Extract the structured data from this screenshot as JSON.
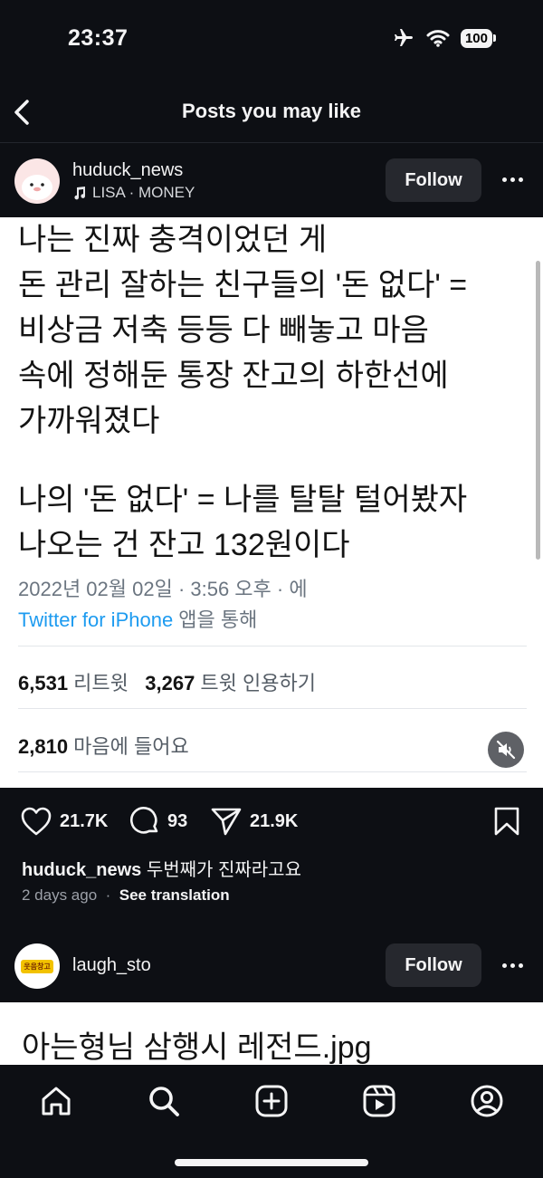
{
  "status_bar": {
    "time": "23:37",
    "battery": "100"
  },
  "nav": {
    "title": "Posts you may like"
  },
  "post1": {
    "username": "huduck_news",
    "music": "LISA · MONEY",
    "follow_label": "Follow",
    "tweet_lines": [
      "나는 진짜 충격이었던 게",
      "돈 관리 잘하는 친구들의 '돈 없다' =",
      "비상금 저축 등등 다 빼놓고 마음",
      "속에 정해둔 통장 잔고의 하한선에",
      "가까워졌다",
      "나의 '돈 없다' = 나를 탈탈 털어봤자",
      "나오는 건 잔고 132원이다"
    ],
    "tweet_meta_date": "2022년 02월 02일 · 3:56 오후 · 에",
    "tweet_meta_client": "Twitter for iPhone",
    "tweet_meta_suffix": " 앱을 통해",
    "retweets_num": "6,531",
    "retweets_label": " 리트윗",
    "quotes_num": "3,267",
    "quotes_label": " 트윗 인용하기",
    "likes_num": "2,810",
    "likes_label": " 마음에 들어요",
    "like_count": "21.7K",
    "comment_count": "93",
    "share_count": "21.9K",
    "caption_user": "huduck_news",
    "caption_text": " 두번째가 진짜라고요",
    "time_ago": "2 days ago",
    "see_translation": "See translation"
  },
  "post2": {
    "username": "laugh_sto",
    "avatar_text": "웃음창고",
    "follow_label": "Follow",
    "image_text": "아는형님 삼행시 레전드.jpg"
  },
  "bottom_nav": [
    "home-icon",
    "search-icon",
    "create-icon",
    "reels-icon",
    "profile-icon"
  ]
}
